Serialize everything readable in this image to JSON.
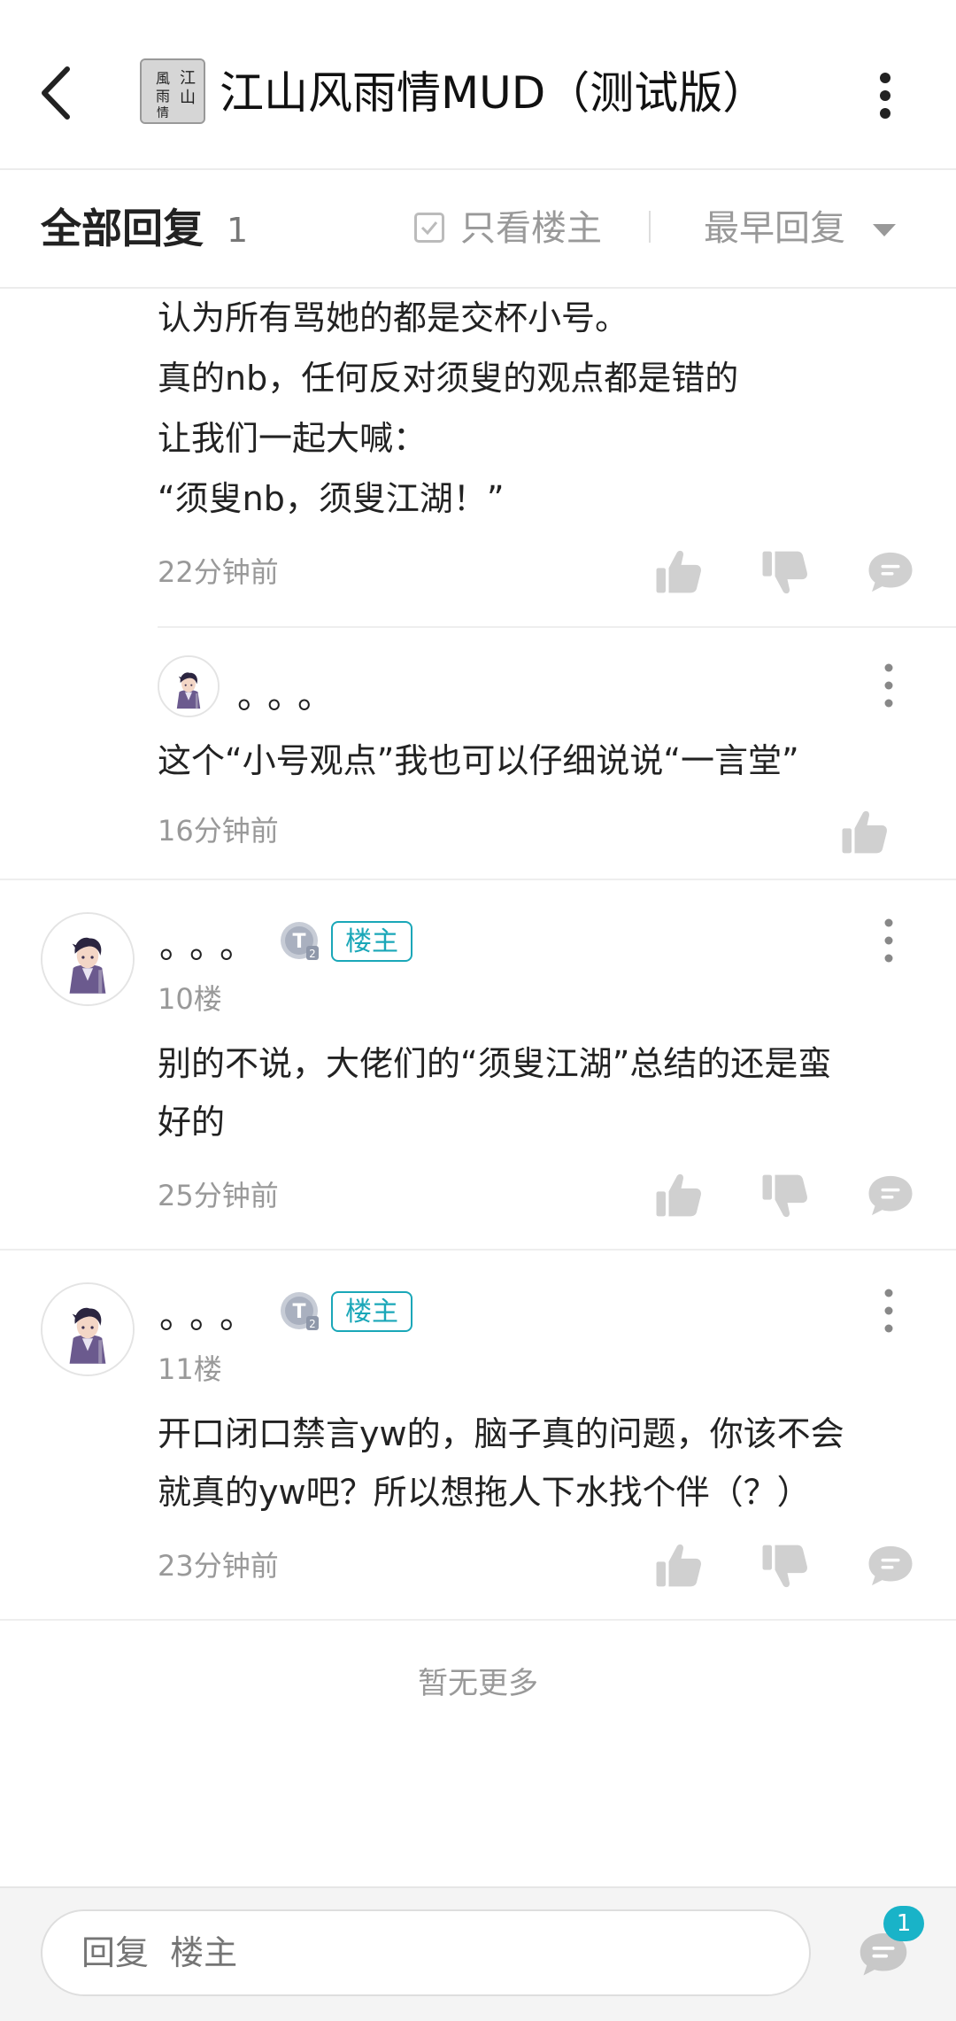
{
  "header": {
    "title": "江山风雨情MUD（测试版）",
    "logo_text": "江山風雨情"
  },
  "filter": {
    "all_label": "全部回复",
    "count": "1",
    "only_op": "只看楼主",
    "sort": "最早回复"
  },
  "top_reply": {
    "lines": [
      "认为所有骂她的都是交杯小号。",
      "真的nb，任何反对须叟的观点都是错的",
      "让我们一起大喊：",
      "“须叟nb，须叟江湖！”"
    ],
    "time": "22分钟前"
  },
  "sub_reply": {
    "username": "。。。",
    "text": "这个“小号观点”我也可以仔细说说“一言堂”",
    "time": "16分钟前"
  },
  "floors": [
    {
      "username": "。。。",
      "level": "T2",
      "badge": "楼主",
      "floor": "10楼",
      "lines": [
        "别的不说，大佬们的“须叟江湖”总结的还是蛮",
        "好的"
      ],
      "time": "25分钟前"
    },
    {
      "username": "。。。",
      "level": "T2",
      "badge": "楼主",
      "floor": "11楼",
      "lines": [
        "开口闭口禁言yw的，脑子真的问题，你该不会",
        "就真的yw吧？所以想拖人下水找个伴（？）"
      ],
      "time": "23分钟前"
    }
  ],
  "no_more": "暂无更多",
  "bottom": {
    "placeholder": "回复  楼主",
    "notification_count": "1"
  },
  "icons": [
    "back-icon",
    "more-icon",
    "checkbox-icon",
    "dropdown-caret-icon",
    "like-icon",
    "dislike-icon",
    "comment-icon",
    "chat-icon"
  ],
  "colors": {
    "accent": "#1aa7b8",
    "icon_gray": "#d0d0d0",
    "text_gray": "#999999"
  }
}
